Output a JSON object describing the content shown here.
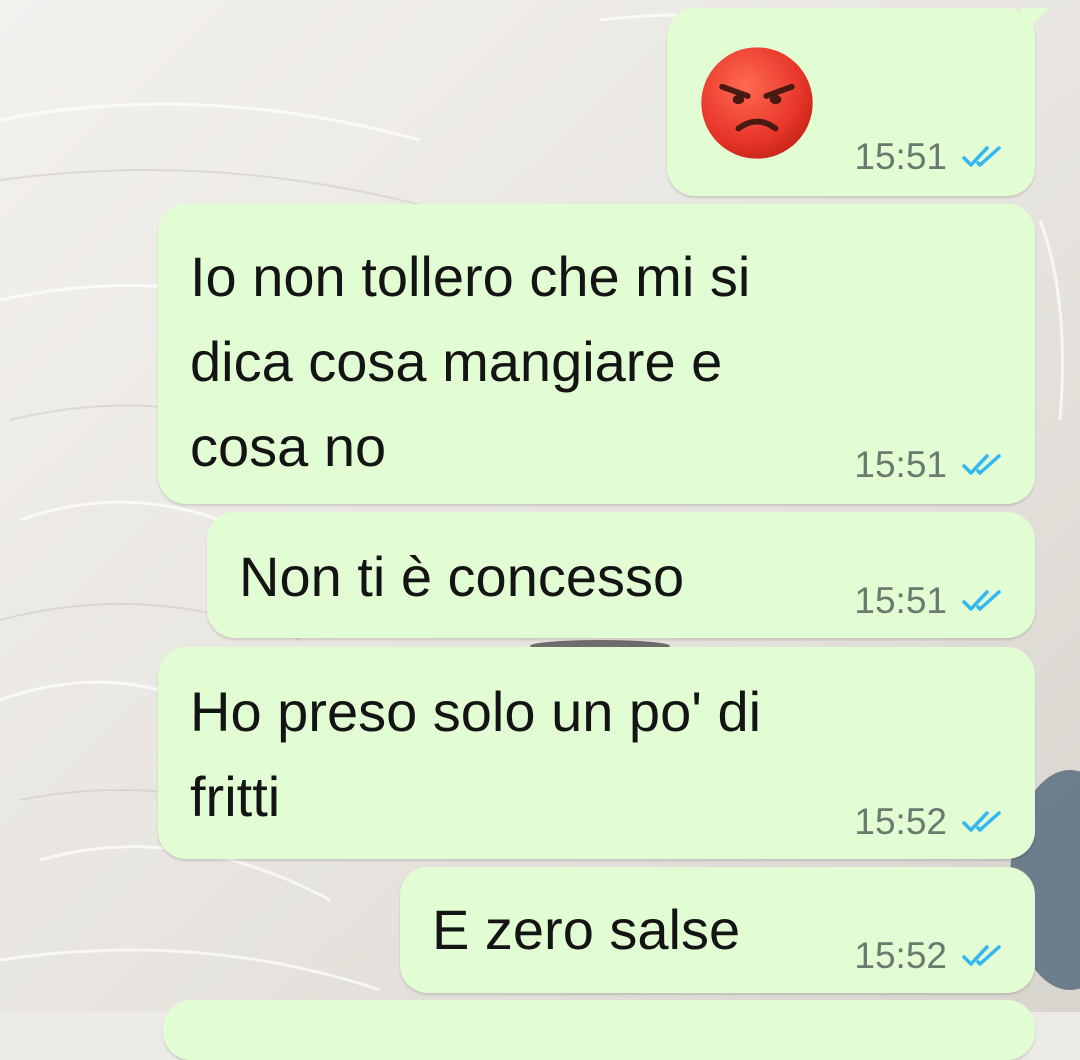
{
  "chat": {
    "messages": [
      {
        "kind": "emoji",
        "emoji": "angry-face-emoji",
        "time": "15:51",
        "status": "read"
      },
      {
        "kind": "text",
        "lines": [
          "Io non tollero che mi si",
          "dica cosa mangiare e",
          "cosa no"
        ],
        "time": "15:51",
        "status": "read"
      },
      {
        "kind": "text",
        "lines": [
          "Non ti è concesso"
        ],
        "time": "15:51",
        "status": "read"
      },
      {
        "kind": "text",
        "lines": [
          "Ho preso solo un po' di",
          "fritti"
        ],
        "time": "15:52",
        "status": "read"
      },
      {
        "kind": "text",
        "lines": [
          "E zero salse"
        ],
        "time": "15:52",
        "status": "read"
      }
    ]
  },
  "colors": {
    "bubble_outgoing": "#e2fdd3",
    "read_ticks": "#34b7f1",
    "timestamp": "#6a7a6e",
    "message_text": "#141414"
  }
}
